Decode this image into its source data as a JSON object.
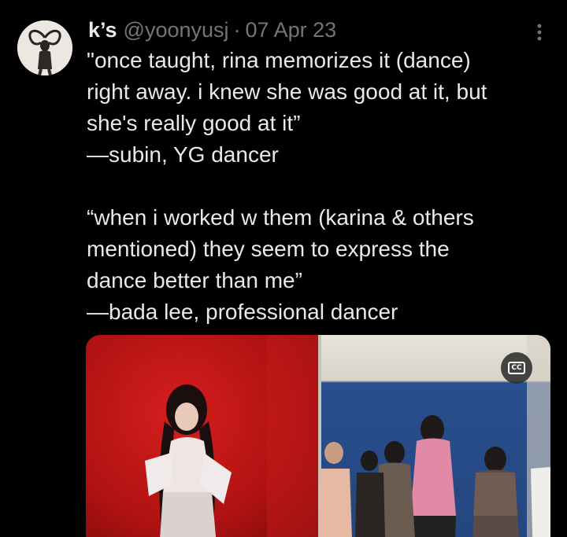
{
  "tweet": {
    "display_name": "k’s",
    "handle": "@yoonyusj",
    "separator": "·",
    "date": "07 Apr 23",
    "lines": [
      "\"once taught, rina memorizes it (dance)",
      "right away. i knew she was good at it, but",
      "she's really good at it”",
      "—subin, YG dancer",
      "",
      "“when i worked w them (karina & others",
      "mentioned) they seem to express the",
      "dance better than me”",
      "—bada lee, professional dancer"
    ]
  },
  "media": {
    "captions_badge": "CC"
  },
  "icons": {
    "avatar": "avatar-image",
    "more": "more-options-icon",
    "captions": "closed-captions-icon"
  },
  "colors": {
    "background": "#000000",
    "text_primary": "#e7e9ea",
    "text_secondary": "#71767b",
    "left_panel_red": "#b01212",
    "right_panel_wall_blue": "#2a4f8e"
  }
}
